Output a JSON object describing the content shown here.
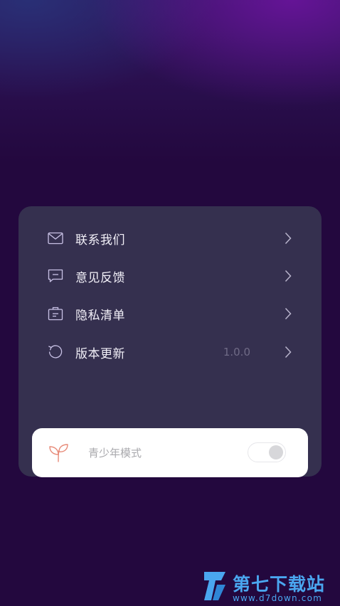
{
  "menu": {
    "items": [
      {
        "label": "联系我们",
        "icon": "mail-icon"
      },
      {
        "label": "意见反馈",
        "icon": "feedback-icon"
      },
      {
        "label": "隐私清单",
        "icon": "privacy-list-icon"
      },
      {
        "label": "版本更新",
        "icon": "refresh-icon",
        "value": "1.0.0"
      }
    ]
  },
  "youth_mode": {
    "label": "青少年模式",
    "enabled": false,
    "icon": "sprout-icon"
  },
  "watermark": {
    "title": "第七下载站",
    "url": "www.d7down.com"
  },
  "colors": {
    "background": "#23083e",
    "card": "#35304f",
    "icon_stroke": "#c9c2e6",
    "sprout": "#e78a78",
    "watermark": "#4aa6ef"
  }
}
